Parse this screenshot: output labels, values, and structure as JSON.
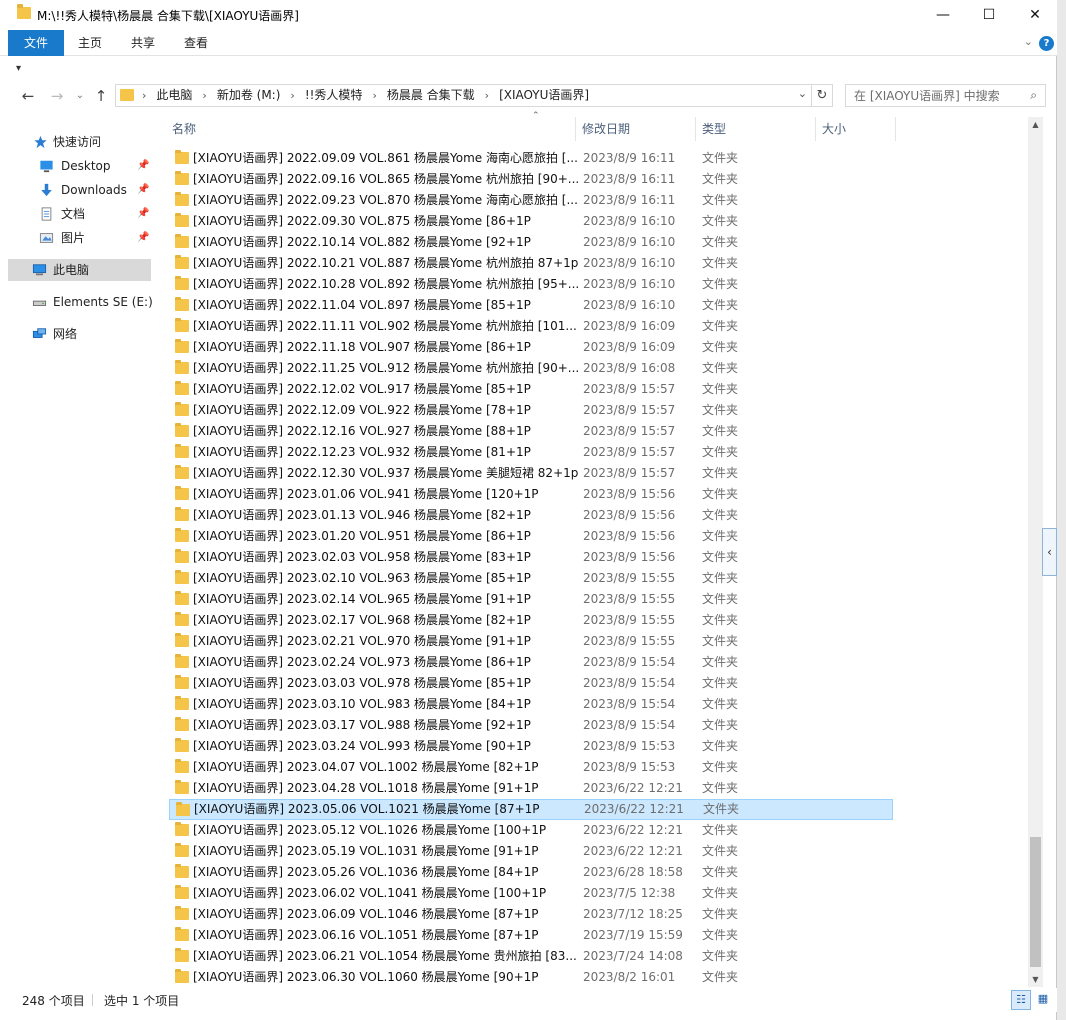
{
  "window": {
    "title": "M:\\!!秀人模特\\杨晨晨 合集下载\\[XIAOYU语画界]",
    "controls": {
      "minimize": "—",
      "maximize": "☐",
      "close": "✕"
    }
  },
  "ribbon": {
    "tabs": [
      "文件",
      "主页",
      "共享",
      "查看"
    ],
    "collapse_glyph": "⌄",
    "help_glyph": "?"
  },
  "qat_glyph": "▾",
  "nav": {
    "back": "←",
    "forward": "→",
    "recent": "⌄",
    "up": "↑",
    "refresh": "↻"
  },
  "address": {
    "crumbs": [
      "此电脑",
      "新加卷 (M:)",
      "!!秀人模特",
      "杨晨晨 合集下载",
      "[XIAOYU语画界]"
    ],
    "sep": "›",
    "dropdown": "⌄"
  },
  "search": {
    "placeholder": "在 [XIAOYU语画界] 中搜索",
    "icon": "⌕"
  },
  "sidebar": {
    "items": [
      {
        "label": "快速访问",
        "icon": "star-icon",
        "pinned": false
      },
      {
        "label": "Desktop",
        "icon": "desktop-icon",
        "pinned": true
      },
      {
        "label": "Downloads",
        "icon": "download-icon",
        "pinned": true
      },
      {
        "label": "文档",
        "icon": "document-icon",
        "pinned": true
      },
      {
        "label": "图片",
        "icon": "picture-icon",
        "pinned": true
      },
      {
        "label": "此电脑",
        "icon": "computer-icon",
        "pinned": false,
        "selected": true
      },
      {
        "label": "Elements SE (E:)",
        "icon": "drive-icon",
        "pinned": false
      },
      {
        "label": "网络",
        "icon": "network-icon",
        "pinned": false
      }
    ],
    "pin_glyph": "📌"
  },
  "columns": {
    "name": "名称",
    "modified": "修改日期",
    "type": "类型",
    "size": "大小",
    "sort_glyph": "⌃"
  },
  "files": [
    {
      "name": "[XIAOYU语画界] 2022.09.09 VOL.861 杨晨晨Yome 海南心愿旅拍 [...",
      "date": "2023/8/9 16:11",
      "type": "文件夹"
    },
    {
      "name": "[XIAOYU语画界] 2022.09.16 VOL.865 杨晨晨Yome 杭州旅拍 [90+...",
      "date": "2023/8/9 16:11",
      "type": "文件夹"
    },
    {
      "name": "[XIAOYU语画界] 2022.09.23 VOL.870 杨晨晨Yome 海南心愿旅拍 [...",
      "date": "2023/8/9 16:11",
      "type": "文件夹"
    },
    {
      "name": "[XIAOYU语画界] 2022.09.30 VOL.875 杨晨晨Yome [86+1P",
      "date": "2023/8/9 16:10",
      "type": "文件夹"
    },
    {
      "name": "[XIAOYU语画界] 2022.10.14 VOL.882 杨晨晨Yome [92+1P",
      "date": "2023/8/9 16:10",
      "type": "文件夹"
    },
    {
      "name": "[XIAOYU语画界] 2022.10.21 VOL.887 杨晨晨Yome 杭州旅拍 87+1p",
      "date": "2023/8/9 16:10",
      "type": "文件夹"
    },
    {
      "name": "[XIAOYU语画界] 2022.10.28 VOL.892 杨晨晨Yome 杭州旅拍 [95+...",
      "date": "2023/8/9 16:10",
      "type": "文件夹"
    },
    {
      "name": "[XIAOYU语画界] 2022.11.04 VOL.897 杨晨晨Yome [85+1P",
      "date": "2023/8/9 16:10",
      "type": "文件夹"
    },
    {
      "name": "[XIAOYU语画界] 2022.11.11 VOL.902 杨晨晨Yome 杭州旅拍 [101...",
      "date": "2023/8/9 16:09",
      "type": "文件夹"
    },
    {
      "name": "[XIAOYU语画界] 2022.11.18 VOL.907 杨晨晨Yome [86+1P",
      "date": "2023/8/9 16:09",
      "type": "文件夹"
    },
    {
      "name": "[XIAOYU语画界] 2022.11.25 VOL.912 杨晨晨Yome 杭州旅拍 [90+...",
      "date": "2023/8/9 16:08",
      "type": "文件夹"
    },
    {
      "name": "[XIAOYU语画界] 2022.12.02 VOL.917 杨晨晨Yome [85+1P",
      "date": "2023/8/9 15:57",
      "type": "文件夹"
    },
    {
      "name": "[XIAOYU语画界] 2022.12.09 VOL.922 杨晨晨Yome [78+1P",
      "date": "2023/8/9 15:57",
      "type": "文件夹"
    },
    {
      "name": "[XIAOYU语画界] 2022.12.16 VOL.927 杨晨晨Yome [88+1P",
      "date": "2023/8/9 15:57",
      "type": "文件夹"
    },
    {
      "name": "[XIAOYU语画界] 2022.12.23 VOL.932 杨晨晨Yome [81+1P",
      "date": "2023/8/9 15:57",
      "type": "文件夹"
    },
    {
      "name": "[XIAOYU语画界] 2022.12.30 VOL.937 杨晨晨Yome 美腿短裙 82+1p",
      "date": "2023/8/9 15:57",
      "type": "文件夹"
    },
    {
      "name": "[XIAOYU语画界] 2023.01.06 VOL.941 杨晨晨Yome [120+1P",
      "date": "2023/8/9 15:56",
      "type": "文件夹"
    },
    {
      "name": "[XIAOYU语画界] 2023.01.13 VOL.946 杨晨晨Yome [82+1P",
      "date": "2023/8/9 15:56",
      "type": "文件夹"
    },
    {
      "name": "[XIAOYU语画界] 2023.01.20 VOL.951 杨晨晨Yome [86+1P",
      "date": "2023/8/9 15:56",
      "type": "文件夹"
    },
    {
      "name": "[XIAOYU语画界] 2023.02.03 VOL.958 杨晨晨Yome [83+1P",
      "date": "2023/8/9 15:56",
      "type": "文件夹"
    },
    {
      "name": "[XIAOYU语画界] 2023.02.10 VOL.963 杨晨晨Yome [85+1P",
      "date": "2023/8/9 15:55",
      "type": "文件夹"
    },
    {
      "name": "[XIAOYU语画界] 2023.02.14 VOL.965 杨晨晨Yome [91+1P",
      "date": "2023/8/9 15:55",
      "type": "文件夹"
    },
    {
      "name": "[XIAOYU语画界] 2023.02.17 VOL.968 杨晨晨Yome [82+1P",
      "date": "2023/8/9 15:55",
      "type": "文件夹"
    },
    {
      "name": "[XIAOYU语画界] 2023.02.21 VOL.970 杨晨晨Yome [91+1P",
      "date": "2023/8/9 15:55",
      "type": "文件夹"
    },
    {
      "name": "[XIAOYU语画界] 2023.02.24 VOL.973 杨晨晨Yome [86+1P",
      "date": "2023/8/9 15:54",
      "type": "文件夹"
    },
    {
      "name": "[XIAOYU语画界] 2023.03.03 VOL.978 杨晨晨Yome [85+1P",
      "date": "2023/8/9 15:54",
      "type": "文件夹"
    },
    {
      "name": "[XIAOYU语画界] 2023.03.10 VOL.983 杨晨晨Yome [84+1P",
      "date": "2023/8/9 15:54",
      "type": "文件夹"
    },
    {
      "name": "[XIAOYU语画界] 2023.03.17 VOL.988 杨晨晨Yome [92+1P",
      "date": "2023/8/9 15:54",
      "type": "文件夹"
    },
    {
      "name": "[XIAOYU语画界] 2023.03.24 VOL.993 杨晨晨Yome [90+1P",
      "date": "2023/8/9 15:53",
      "type": "文件夹"
    },
    {
      "name": "[XIAOYU语画界] 2023.04.07 VOL.1002 杨晨晨Yome [82+1P",
      "date": "2023/8/9 15:53",
      "type": "文件夹"
    },
    {
      "name": "[XIAOYU语画界] 2023.04.28 VOL.1018 杨晨晨Yome [91+1P",
      "date": "2023/6/22 12:21",
      "type": "文件夹"
    },
    {
      "name": "[XIAOYU语画界] 2023.05.06 VOL.1021 杨晨晨Yome [87+1P",
      "date": "2023/6/22 12:21",
      "type": "文件夹",
      "selected": true
    },
    {
      "name": "[XIAOYU语画界] 2023.05.12 VOL.1026 杨晨晨Yome [100+1P",
      "date": "2023/6/22 12:21",
      "type": "文件夹"
    },
    {
      "name": "[XIAOYU语画界] 2023.05.19 VOL.1031 杨晨晨Yome [91+1P",
      "date": "2023/6/22 12:21",
      "type": "文件夹"
    },
    {
      "name": "[XIAOYU语画界] 2023.05.26 VOL.1036 杨晨晨Yome [84+1P",
      "date": "2023/6/28 18:58",
      "type": "文件夹"
    },
    {
      "name": "[XIAOYU语画界] 2023.06.02 VOL.1041 杨晨晨Yome [100+1P",
      "date": "2023/7/5 12:38",
      "type": "文件夹"
    },
    {
      "name": "[XIAOYU语画界] 2023.06.09 VOL.1046 杨晨晨Yome [87+1P",
      "date": "2023/7/12 18:25",
      "type": "文件夹"
    },
    {
      "name": "[XIAOYU语画界] 2023.06.16 VOL.1051 杨晨晨Yome [87+1P",
      "date": "2023/7/19 15:59",
      "type": "文件夹"
    },
    {
      "name": "[XIAOYU语画界] 2023.06.21 VOL.1054 杨晨晨Yome 贵州旅拍 [83...",
      "date": "2023/7/24 14:08",
      "type": "文件夹"
    },
    {
      "name": "[XIAOYU语画界] 2023.06.30 VOL.1060 杨晨晨Yome [90+1P",
      "date": "2023/8/2 16:01",
      "type": "文件夹"
    }
  ],
  "scroll": {
    "up": "▲",
    "down": "▼",
    "handle": "‹"
  },
  "status": {
    "count": "248 个项目",
    "selected": "选中 1 个项目",
    "details_glyph": "☷",
    "tiles_glyph": "▦"
  },
  "colors": {
    "accent": "#1979ca",
    "selection_bg": "#cce8ff",
    "selection_border": "#99d1ff",
    "folder": "#f5c54a"
  }
}
